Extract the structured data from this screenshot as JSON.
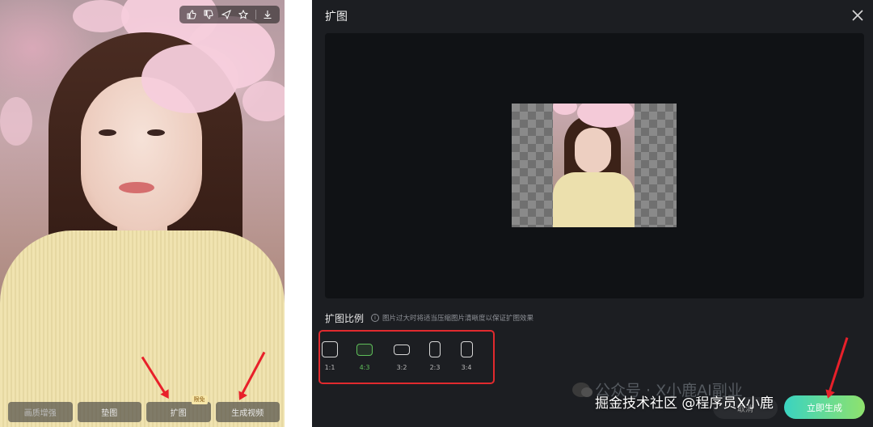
{
  "photo_panel": {
    "toolbar_icons": [
      "thumbs-up-icon",
      "thumbs-down-icon",
      "send-icon",
      "star-icon",
      "download-icon"
    ],
    "actions": [
      {
        "label": "画质增强",
        "badge": ""
      },
      {
        "label": "垫图",
        "badge": ""
      },
      {
        "label": "扩图",
        "badge": "限免"
      },
      {
        "label": "生成视频",
        "badge": ""
      }
    ]
  },
  "dialog": {
    "title": "扩图",
    "close_icon": "close-icon",
    "ratio_section_label": "扩图比例",
    "ratio_hint": "图片过大时将适当压缩图片清晰度以保证扩图效果",
    "ratios": [
      {
        "label": "1:1",
        "active": false
      },
      {
        "label": "4:3",
        "active": true
      },
      {
        "label": "3:2",
        "active": false
      },
      {
        "label": "2:3",
        "active": false
      },
      {
        "label": "3:4",
        "active": false
      }
    ],
    "cancel_label": "取消",
    "confirm_label": "立即生成"
  },
  "watermark": {
    "line1": "公众号 · X小鹿AI副业",
    "line2": "掘金技术社区 @程序员X小鹿"
  },
  "colors": {
    "dialog_bg": "#1c1e22",
    "accent_green": "#5fbf5a",
    "highlight_red": "#e12a2e",
    "confirm_gradient_start": "#3ad3c1",
    "confirm_gradient_end": "#8fe26d"
  }
}
